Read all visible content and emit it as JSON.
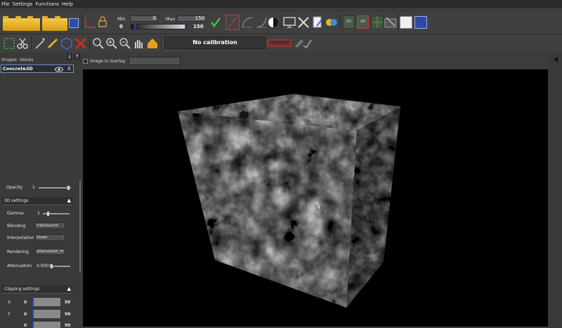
{
  "menu": [
    "File",
    "Settings",
    "Functions",
    "Help"
  ],
  "toolbar": {
    "min_label": "Min",
    "max_label": "Max",
    "min_value": "0",
    "max_value": "150",
    "min_display": "0",
    "max_display": "150",
    "btn_2d": "2D",
    "btn_3d": "3D",
    "calibration": "No calibration"
  },
  "left": {
    "tabs": [
      "Images",
      "Values"
    ],
    "image_name": "Concrete3D",
    "close": "X",
    "opacity_label": "Opacity",
    "opacity_value": "1",
    "settings3d_title": "3D settings",
    "gamma_label": "Gamma",
    "gamma_value": "1",
    "blending_label": "Blending",
    "blending_value": "translucent",
    "interpolation_label": "Interpolation",
    "interpolation_value": "linear",
    "rendering_label": "Rendering",
    "rendering_value": "attenuated_m",
    "attenuation_label": "Attenuation",
    "attenuation_value": "0.0001",
    "clipping_title": "Clipping settings",
    "clip_x_label": "X",
    "clip_y_label": "Y",
    "clip_x_min": "0",
    "clip_x_max": "99",
    "clip_y_min": "0",
    "clip_y_max": "99",
    "clip_z_min": "0",
    "clip_z_max": "99"
  },
  "viewer": {
    "overlay_label": "Image in overlay",
    "overlay_value": ""
  },
  "colors": {
    "accent": "#2448b8",
    "toolbar_bg": "#404040",
    "panel_bg": "#3a3a3a"
  }
}
